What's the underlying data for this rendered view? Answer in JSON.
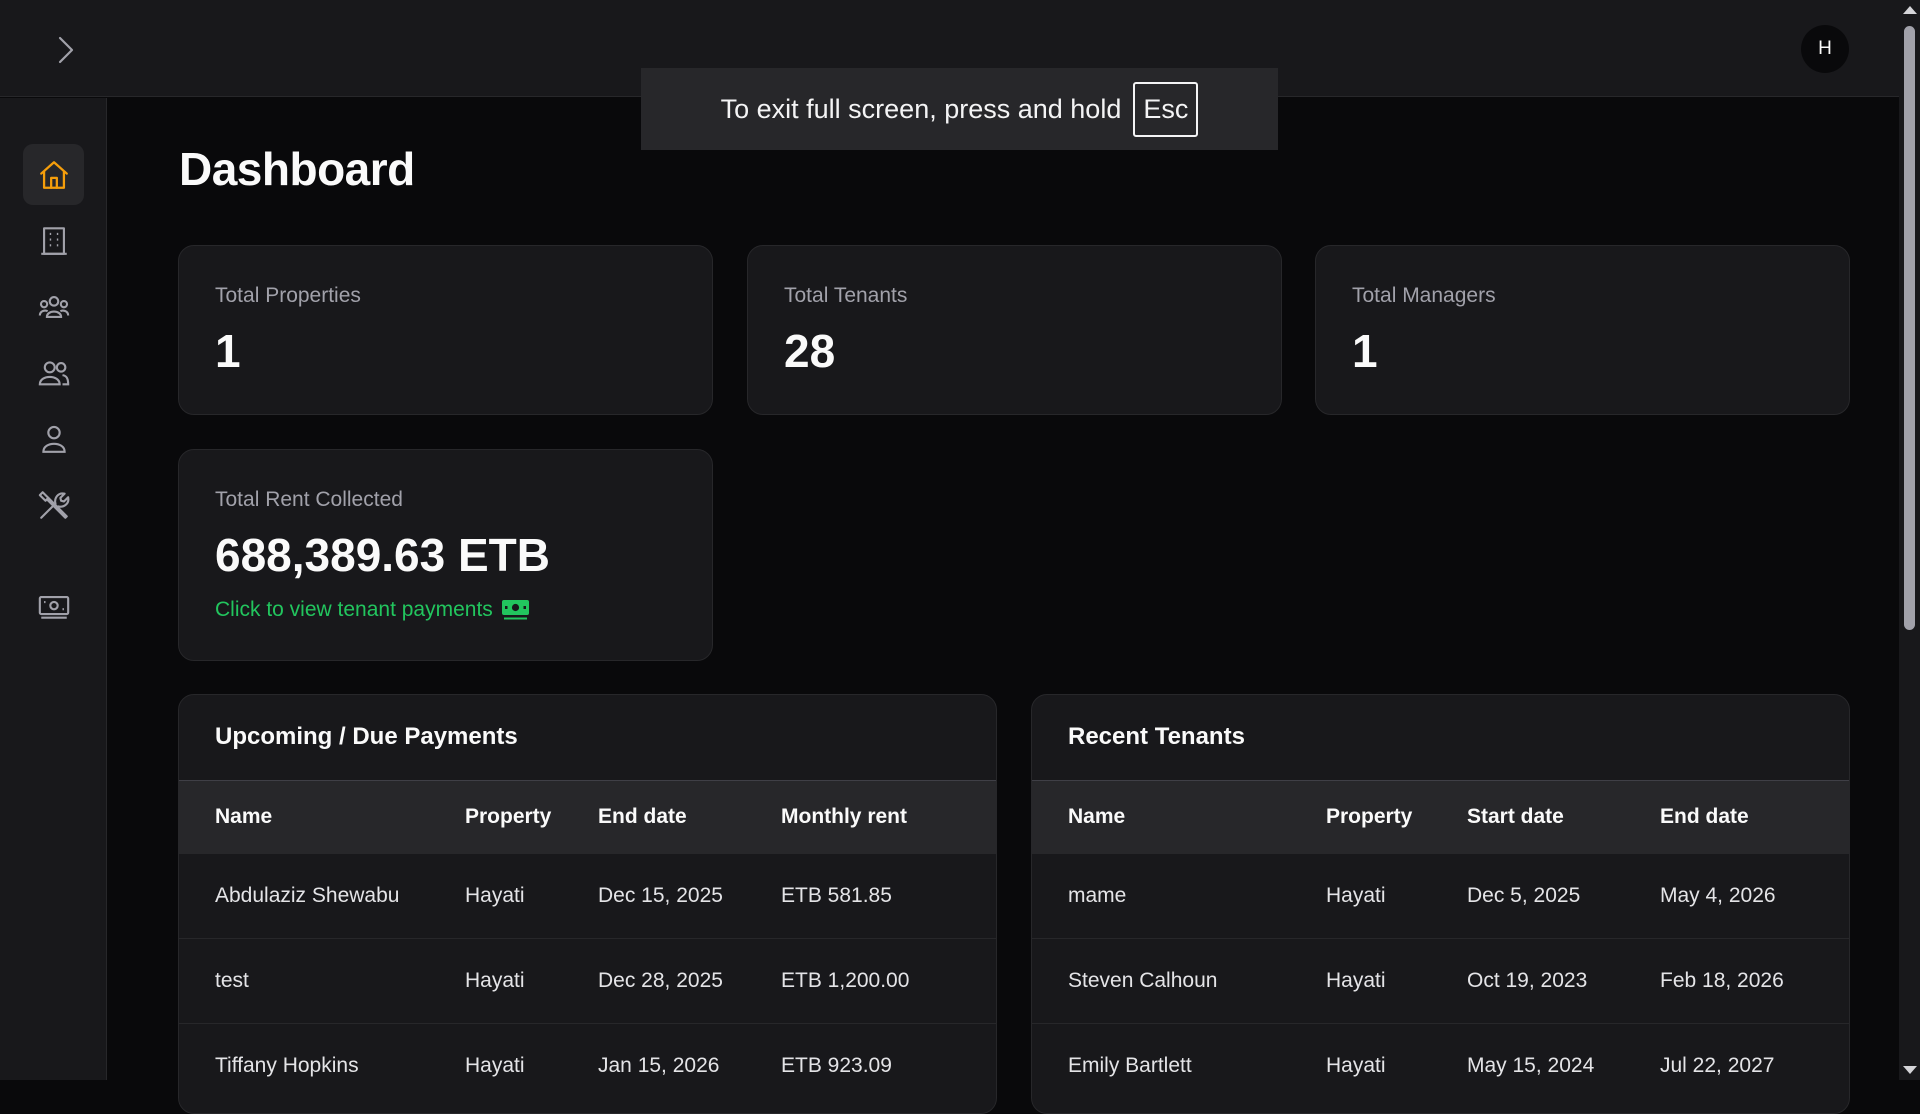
{
  "header": {
    "expand_icon": "chevron-right-icon",
    "avatar_initial": "H"
  },
  "fullscreen_toast": {
    "message": "To exit full screen, press and hold",
    "key": "Esc"
  },
  "sidebar": {
    "accent_color": "#f59e0b",
    "items": [
      {
        "icon": "home-icon",
        "active": true
      },
      {
        "icon": "building-icon",
        "active": false
      },
      {
        "icon": "users-group-icon",
        "active": false
      },
      {
        "icon": "users-icon",
        "active": false
      },
      {
        "icon": "user-icon",
        "active": false
      },
      {
        "icon": "tools-icon",
        "active": false
      },
      {
        "icon": "cash-icon",
        "active": false
      }
    ]
  },
  "page": {
    "title": "Dashboard"
  },
  "stats": {
    "properties": {
      "label": "Total Properties",
      "value": "1"
    },
    "tenants": {
      "label": "Total Tenants",
      "value": "28"
    },
    "managers": {
      "label": "Total Managers",
      "value": "1"
    },
    "rent": {
      "label": "Total Rent Collected",
      "value": "688,389.63 ETB",
      "link": "Click to view tenant payments",
      "link_color": "#22c55e"
    }
  },
  "upcoming_payments": {
    "title": "Upcoming / Due Payments",
    "columns": [
      "Name",
      "Property",
      "End date",
      "Monthly rent"
    ],
    "rows": [
      [
        "Abdulaziz Shewabu",
        "Hayati",
        "Dec 15, 2025",
        "ETB 581.85"
      ],
      [
        "test",
        "Hayati",
        "Dec 28, 2025",
        "ETB 1,200.00"
      ],
      [
        "Tiffany Hopkins",
        "Hayati",
        "Jan 15, 2026",
        "ETB 923.09"
      ]
    ]
  },
  "recent_tenants": {
    "title": "Recent Tenants",
    "columns": [
      "Name",
      "Property",
      "Start date",
      "End date"
    ],
    "rows": [
      [
        "mame",
        "Hayati",
        "Dec 5, 2025",
        "May 4, 2026"
      ],
      [
        "Steven Calhoun",
        "Hayati",
        "Oct 19, 2023",
        "Feb 18, 2026"
      ],
      [
        "Emily Bartlett",
        "Hayati",
        "May 15, 2024",
        "Jul 22, 2027"
      ]
    ]
  }
}
